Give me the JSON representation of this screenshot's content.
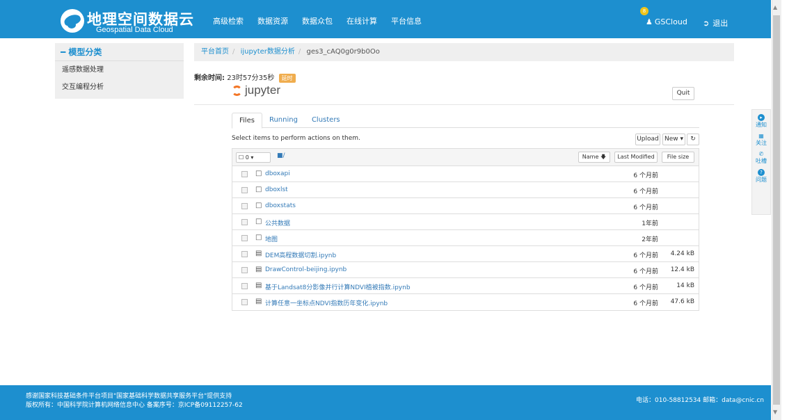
{
  "header": {
    "title": "地理空间数据云",
    "subtitle": "Geospatial Data Cloud",
    "nav": [
      "高级检索",
      "数据资源",
      "数据众包",
      "在线计算",
      "平台信息"
    ],
    "badge": "8",
    "user": "GSCloud",
    "logout": "退出"
  },
  "sidebar": {
    "heading": "模型分类",
    "items": [
      "遥感数据处理",
      "交互编程分析"
    ]
  },
  "breadcrumb": {
    "home": "平台首页",
    "section": "ijupyter数据分析",
    "current": "ges3_cAQ0g0r9b0Oo"
  },
  "timer": {
    "label": "剩余时间:",
    "value": "23时57分35秒",
    "button": "延时"
  },
  "jupyter": {
    "logo": "jupyter",
    "quit": "Quit",
    "tabs": [
      "Files",
      "Running",
      "Clusters"
    ],
    "select_msg": "Select items to perform actions on them.",
    "upload": "Upload",
    "new": "New",
    "head": {
      "count": "0",
      "path": "/",
      "name": "Name",
      "modified": "Last Modified",
      "size": "File size"
    },
    "files": [
      {
        "name": "dboxapi",
        "type": "folder",
        "modified": "6 个月前",
        "size": ""
      },
      {
        "name": "dboxlst",
        "type": "folder",
        "modified": "6 个月前",
        "size": ""
      },
      {
        "name": "dboxstats",
        "type": "folder",
        "modified": "6 个月前",
        "size": ""
      },
      {
        "name": "公共数据",
        "type": "folder",
        "modified": "1年前",
        "size": ""
      },
      {
        "name": "地图",
        "type": "folder",
        "modified": "2年前",
        "size": ""
      },
      {
        "name": "DEM高程数据切割.ipynb",
        "type": "notebook",
        "modified": "6 个月前",
        "size": "4.24 kB"
      },
      {
        "name": "DrawControl-beijing.ipynb",
        "type": "notebook",
        "modified": "6 个月前",
        "size": "12.4 kB"
      },
      {
        "name": "基于Landsat8分影像并行计算NDVI植被指数.ipynb",
        "type": "notebook",
        "modified": "6 个月前",
        "size": "14 kB"
      },
      {
        "name": "计算任意一坐标点NDVI指数历年变化.ipynb",
        "type": "notebook",
        "modified": "6 个月前",
        "size": "47.6 kB"
      }
    ]
  },
  "float_panel": [
    "通知",
    "关注",
    "吐槽",
    "问题"
  ],
  "footer": {
    "line1": "感谢国家科技基础条件平台项目\"国家基础科学数据共享服务平台\"提供支持",
    "line2": "版权所有：中国科学院计算机网络信息中心 备案序号：京ICP备09112257-62",
    "contact": "电话：010-58812534    邮箱：data@cnic.cn"
  }
}
